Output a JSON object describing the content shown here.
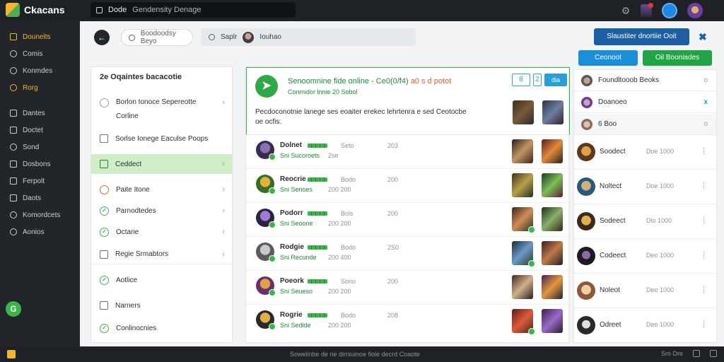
{
  "topbar": {
    "app_name": "Ckacans",
    "search_text": "Dode",
    "search_hint": "Gendensity Denage"
  },
  "sidebar": {
    "items": [
      {
        "label": "Dounelts",
        "icon": "grid-icon"
      },
      {
        "label": "Comis",
        "icon": "target-icon"
      },
      {
        "label": "Konmdes",
        "icon": "gear-icon"
      },
      {
        "label": "Rorg",
        "icon": "coin-icon"
      },
      {
        "label": "Dantes",
        "icon": "list-icon"
      },
      {
        "label": "Doctet",
        "icon": "list-icon"
      },
      {
        "label": "Sond",
        "icon": "users-icon"
      },
      {
        "label": "Dosbons",
        "icon": "layers-icon"
      },
      {
        "label": "Ferpolt",
        "icon": "file-icon"
      },
      {
        "label": "Daots",
        "icon": "list-icon"
      },
      {
        "label": "Komordcets",
        "icon": "globe-icon"
      },
      {
        "label": "Aonios",
        "icon": "link-icon"
      }
    ],
    "fab_label": "G"
  },
  "header": {
    "search_pill": "Boodoodsy Beyo",
    "search2_label": "Saplr",
    "search2_value": "Iouhao",
    "primary_button": "Slaustiter dnortiie Ooit"
  },
  "left_panel": {
    "title": "2e   Oqaintes bacacotie",
    "items": [
      {
        "label": "Borlon tonoce Sepereotte",
        "sub": "Corline"
      },
      {
        "label": "Sorlse Ionege Eaculse Poops"
      },
      {
        "label": "Ceddect"
      },
      {
        "label": "Paite Itone"
      },
      {
        "label": "Parnodtedes"
      },
      {
        "label": "Octarie"
      },
      {
        "label": "Regie Srmabtors"
      },
      {
        "label": "Aotlice"
      },
      {
        "label": "Narners"
      },
      {
        "label": "Conlinocnies"
      }
    ]
  },
  "feature": {
    "title": "Senoomnine fide online -",
    "title_nums": "Ce0(0/f4)",
    "title_muted": "a0 s d potot",
    "subtitle": "Conmidor lnnie 20 Sobol",
    "description": "Pecdoconotnie lanege ses eoaiter erekec lehrtenra e sed Ceotocbe oe ocfis.",
    "btn_outline": "8",
    "btn_small": "2",
    "btn_solid": "dia"
  },
  "rows": [
    {
      "name": "Dolnet",
      "meta": "Seto",
      "num": "203",
      "sub": "Sni Sucoroets",
      "sub2": "2se"
    },
    {
      "name": "Reocrie",
      "meta": "Bodo",
      "num": "200",
      "sub": "Sni Senoes",
      "sub2": "200 200"
    },
    {
      "name": "Podorr",
      "meta": "Bols",
      "num": "200",
      "sub": "Sni Seoone",
      "sub2": "200 200"
    },
    {
      "name": "Rodgie",
      "meta": "Bodo",
      "num": "2S0",
      "sub": "Sni Recunde",
      "sub2": "200 400"
    },
    {
      "name": "Poeork",
      "meta": "Sono",
      "num": "200",
      "sub": "Sni Seueso",
      "sub2": "200 200"
    },
    {
      "name": "Rogrie",
      "meta": "Bodo",
      "num": "208",
      "sub": "Sni Sedlde",
      "sub2": "200 200"
    }
  ],
  "right_panel": {
    "btn_blue": "Ceonoot",
    "btn_green": "Oil  Booniades",
    "top_rows": [
      {
        "label": "Foundltooob Beoks",
        "end": "o"
      },
      {
        "label": "Doanoeo",
        "end": "x"
      },
      {
        "label": "6  Boo",
        "end": "o"
      }
    ],
    "friends": [
      {
        "name": "Soodect",
        "num": "Doe   1000"
      },
      {
        "name": "Noltect",
        "num": "Doe   1000"
      },
      {
        "name": "Sodeect",
        "num": "Dlo   1000"
      },
      {
        "name": "Codeect",
        "num": "Deo   1000"
      },
      {
        "name": "Noleot",
        "num": "Deo   1000"
      },
      {
        "name": "Odreet",
        "num": "Deo   1000"
      }
    ]
  },
  "bottombar": {
    "center_text": "Sowelinbe de rie dirniuinoe fiole decrd Coaote",
    "right_text": "Sro Dre"
  },
  "colors": {
    "accent_green": "#3bb54a",
    "accent_blue": "#1d5fa3",
    "sidebar_active": "#f2b632",
    "dark": "#1e2227"
  }
}
